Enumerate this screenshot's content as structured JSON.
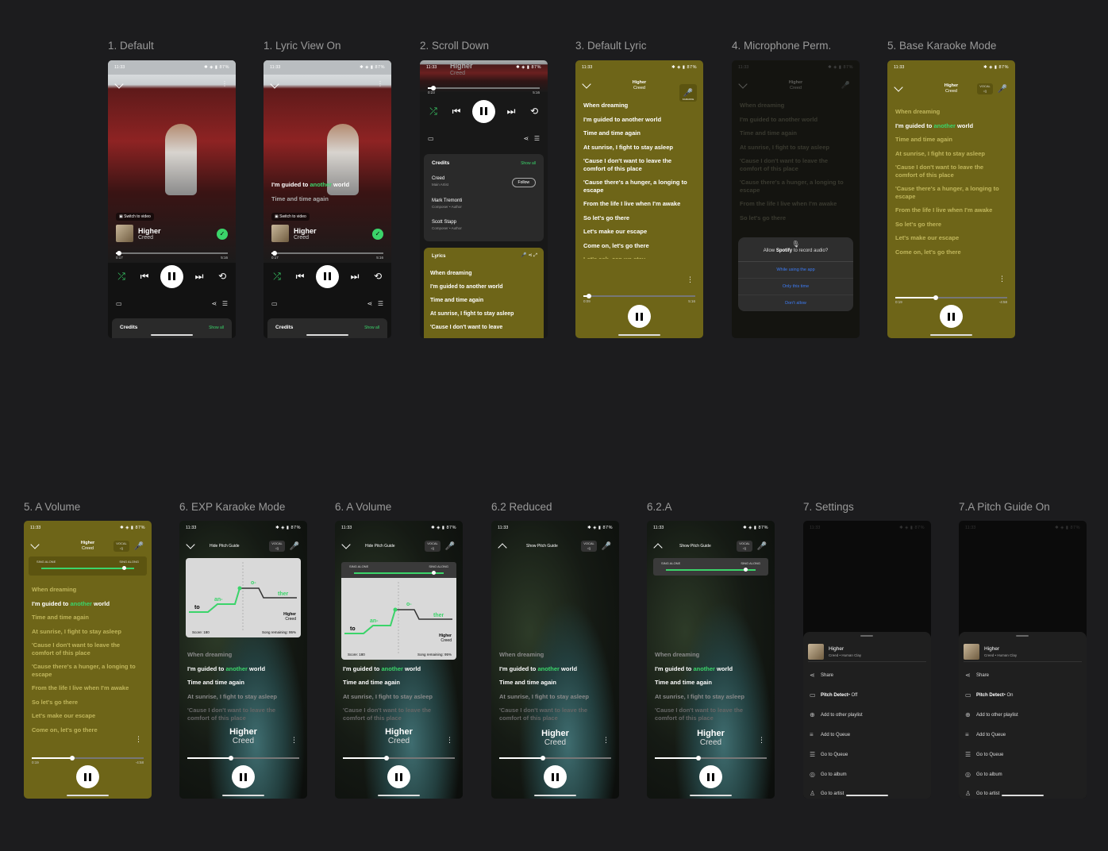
{
  "screens": {
    "s1": {
      "label": "1. Default",
      "time": "11:33",
      "status": "87%",
      "switch": "Switch to video",
      "song": "Higher",
      "artist": "Creed",
      "t0": "0:17",
      "t1": "5:16",
      "credits": "Credits",
      "show_all": "Show all"
    },
    "s2": {
      "label": "1. Lyric View On",
      "time": "11:33",
      "status": "87%",
      "lyric1a": "I'm guided to ",
      "lyric1b": "another",
      "lyric1c": " world",
      "lyric2": "Time and time again",
      "switch": "Switch to video",
      "song": "Higher",
      "artist": "Creed",
      "t0": "0:17",
      "t1": "5:16",
      "credits": "Credits",
      "show_all": "Show all"
    },
    "s3": {
      "label": "2. Scroll Down",
      "time": "11:33",
      "status": "87%",
      "song": "Higher",
      "artist": "Creed",
      "t0": "0:23",
      "t1": "5:16",
      "credits": "Credits",
      "show_all": "Show all",
      "credit_rows": [
        {
          "name": "Creed",
          "role": "Main Artist"
        },
        {
          "name": "Mark Tremonti",
          "role": "Composer • Author"
        },
        {
          "name": "Scott Stapp",
          "role": "Composer • Author"
        }
      ],
      "follow": "Follow",
      "lyrics": "Lyrics",
      "lines": [
        "When dreaming",
        "I'm guided to another world",
        "Time and time again",
        "At sunrise, I fight to stay asleep",
        "'Cause I don't want to leave"
      ]
    },
    "s4": {
      "label": "3. Default Lyric",
      "time": "11:33",
      "title": "Higher",
      "artist": "Creed",
      "karaoke": "KARAOKE",
      "lines": [
        "When dreaming",
        "I'm guided to another world",
        "Time and time again",
        "At sunrise, I fight to stay asleep",
        "'Cause I don't want to leave the comfort of this place",
        "'Cause there's a hunger, a longing to escape",
        "From the life I live when I'm awake",
        "So let's go there",
        "Let's make our escape",
        "Come on, let's go there",
        "Let's ask, can we stay"
      ],
      "t0": "0:09",
      "t1": "5:16"
    },
    "s5": {
      "label": "4. Microphone Perm.",
      "time": "11:33",
      "title": "Higher",
      "artist": "Creed",
      "lines": [
        "When dreaming",
        "I'm guided to another world",
        "Time and time again",
        "At sunrise, I fight to stay asleep",
        "'Cause I don't want to leave the comfort of this place",
        "'Cause there's a hunger, a longing to escape",
        "From the life I live when I'm awake",
        "So let's go there"
      ],
      "dlg_a": "Allow ",
      "dlg_b": "Spotify",
      "dlg_c": " to record audio?",
      "opt1": "While using the app",
      "opt2": "Only this time",
      "opt3": "Don't allow"
    },
    "s6": {
      "label": "5. Base Karaoke Mode",
      "time": "11:33",
      "title": "Higher",
      "artist": "Creed",
      "vocal": "VOCAL",
      "lines": [
        "When dreaming",
        "I'm guided to another world",
        "Time and time again",
        "At sunrise, I fight to stay asleep",
        "'Cause I don't want to leave the comfort of this place",
        "'Cause there's a hunger, a longing to escape",
        "From the life I live when I'm awake",
        "So let's go there",
        "Let's make our escape",
        "Come on, let's go there"
      ],
      "t0": "0:19",
      "t1": "-4:58"
    },
    "s7": {
      "label": "5. A Volume",
      "time": "11:33",
      "title": "Higher",
      "artist": "Creed",
      "vocal": "VOCAL",
      "sing_alone": "SING ALONE",
      "sing_along": "SING ALONG",
      "lines": [
        "When dreaming",
        "I'm guided to another world",
        "Time and time again",
        "At sunrise, I fight to stay asleep",
        "'Cause I don't want to leave the comfort of this place",
        "'Cause there's a hunger, a longing to escape",
        "From the life I live when I'm awake",
        "So let's go there",
        "Let's make our escape",
        "Come on, let's go there"
      ],
      "t0": "0:19",
      "t1": "-4:58"
    },
    "s8": {
      "label": "6. EXP Karaoke Mode",
      "time": "11:33",
      "hide": "Hide Pitch Guide",
      "vocal": "VOCAL",
      "syl": [
        "to",
        "an-",
        "o-",
        "ther"
      ],
      "score": "Score: 180",
      "remain": "Song remaining: 95%",
      "p_song": "Higher",
      "p_artist": "Creed",
      "lines": [
        "When dreaming",
        "I'm guided to another world",
        "Time and time again",
        "At sunrise, I fight to stay asleep",
        "'Cause I don't want to leave the comfort of this place"
      ],
      "song": "Higher",
      "artist": "Creed"
    },
    "s9": {
      "label": "6. A Volume",
      "time": "11:33",
      "hide": "Hide Pitch Guide",
      "vocal": "VOCAL",
      "sing_alone": "SING ALONE",
      "sing_along": "SING ALONG",
      "syl": [
        "to",
        "an-",
        "o-",
        "ther"
      ],
      "score": "Score: 180",
      "remain": "Song remaining: 95%",
      "p_song": "Higher",
      "p_artist": "Creed",
      "lines": [
        "When dreaming",
        "I'm guided to another world",
        "Time and time again",
        "At sunrise, I fight to stay asleep",
        "'Cause I don't want to leave the comfort of this place"
      ],
      "song": "Higher",
      "artist": "Creed"
    },
    "s10": {
      "label": "6.2 Reduced",
      "time": "11:33",
      "show": "Show Pitch Guide",
      "vocal": "VOCAL",
      "lines": [
        "When dreaming",
        "I'm guided to another world",
        "Time and time again",
        "At sunrise, I fight to stay asleep",
        "'Cause I don't want to leave the comfort of this place"
      ],
      "song": "Higher",
      "artist": "Creed"
    },
    "s11": {
      "label": "6.2.A",
      "time": "11:33",
      "show": "Show Pitch Guide",
      "vocal": "VOCAL",
      "sing_alone": "SING ALONE",
      "sing_along": "SING ALONG",
      "lines": [
        "When dreaming",
        "I'm guided to another world",
        "Time and time again",
        "At sunrise, I fight to stay asleep",
        "'Cause I don't want to leave the comfort of this place"
      ],
      "song": "Higher",
      "artist": "Creed"
    },
    "s12": {
      "label": "7. Settings",
      "song": "Higher",
      "sub": "Creed • Human Clay",
      "share": "Share",
      "pitch_a": "Pitch Detect",
      "pitch_b": " • Off",
      "add_pl": "Add to other playlist",
      "add_q": "Add to Queue",
      "go_q": "Go to Queue",
      "go_al": "Go to album",
      "go_ar": "Go to artist"
    },
    "s13": {
      "label": "7.A Pitch Guide On",
      "song": "Higher",
      "sub": "Creed • Human Clay",
      "share": "Share",
      "pitch_a": "Pitch Detect",
      "pitch_b": " • On",
      "add_pl": "Add to other playlist",
      "add_q": "Add to Queue",
      "go_q": "Go to Queue",
      "go_al": "Go to album",
      "go_ar": "Go to artist"
    }
  },
  "colors": {
    "accent": "#3bd46a",
    "olive": "#6e6518"
  }
}
